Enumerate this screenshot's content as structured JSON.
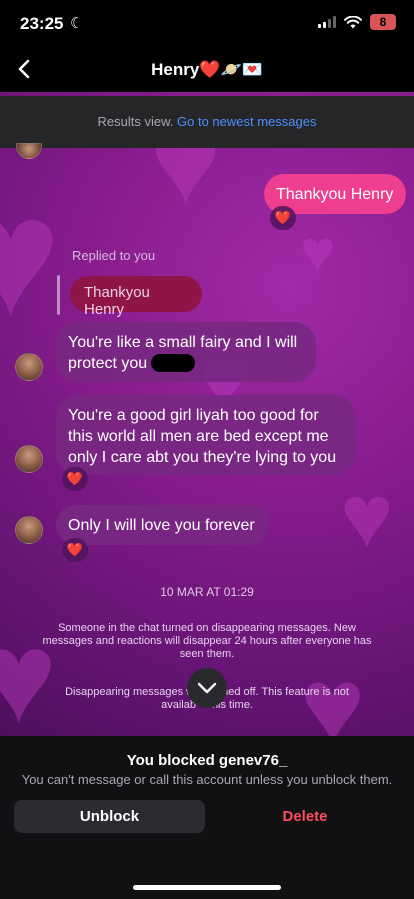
{
  "status": {
    "time": "23:25",
    "battery": "8"
  },
  "header": {
    "title": "Henry❤️🪐💌"
  },
  "results": {
    "text": "Results view. ",
    "link": "Go to newest messages"
  },
  "messages": {
    "out1": "Thankyou Henry",
    "replied_label": "Replied to you",
    "quote": "Thankyou Henry",
    "in1": "You're like a small fairy and I will protect you",
    "in2": "You're a good girl liyah too good for this world all men are bed except me only I care abt you they're lying to you",
    "in3": "Only I will love you forever",
    "reaction": "❤️"
  },
  "date": "10 MAR AT 01:29",
  "system": {
    "msg1": "Someone in the chat turned on disappearing messages. New messages and reactions will disappear 24 hours after everyone has seen them.",
    "msg2_a": "Disappearing messages w",
    "msg2_b": "ned off. This feature is not",
    "msg2_c": "availab",
    "msg2_d": "his time."
  },
  "blocked": {
    "title": "You blocked genev76_",
    "subtitle": "You can't message or call this account unless you unblock them.",
    "unblock_label": "Unblock",
    "delete_label": "Delete"
  },
  "colors": {
    "outgoing": "#ee3e8f",
    "link": "#4a90ff",
    "delete": "#ff4b5c"
  }
}
